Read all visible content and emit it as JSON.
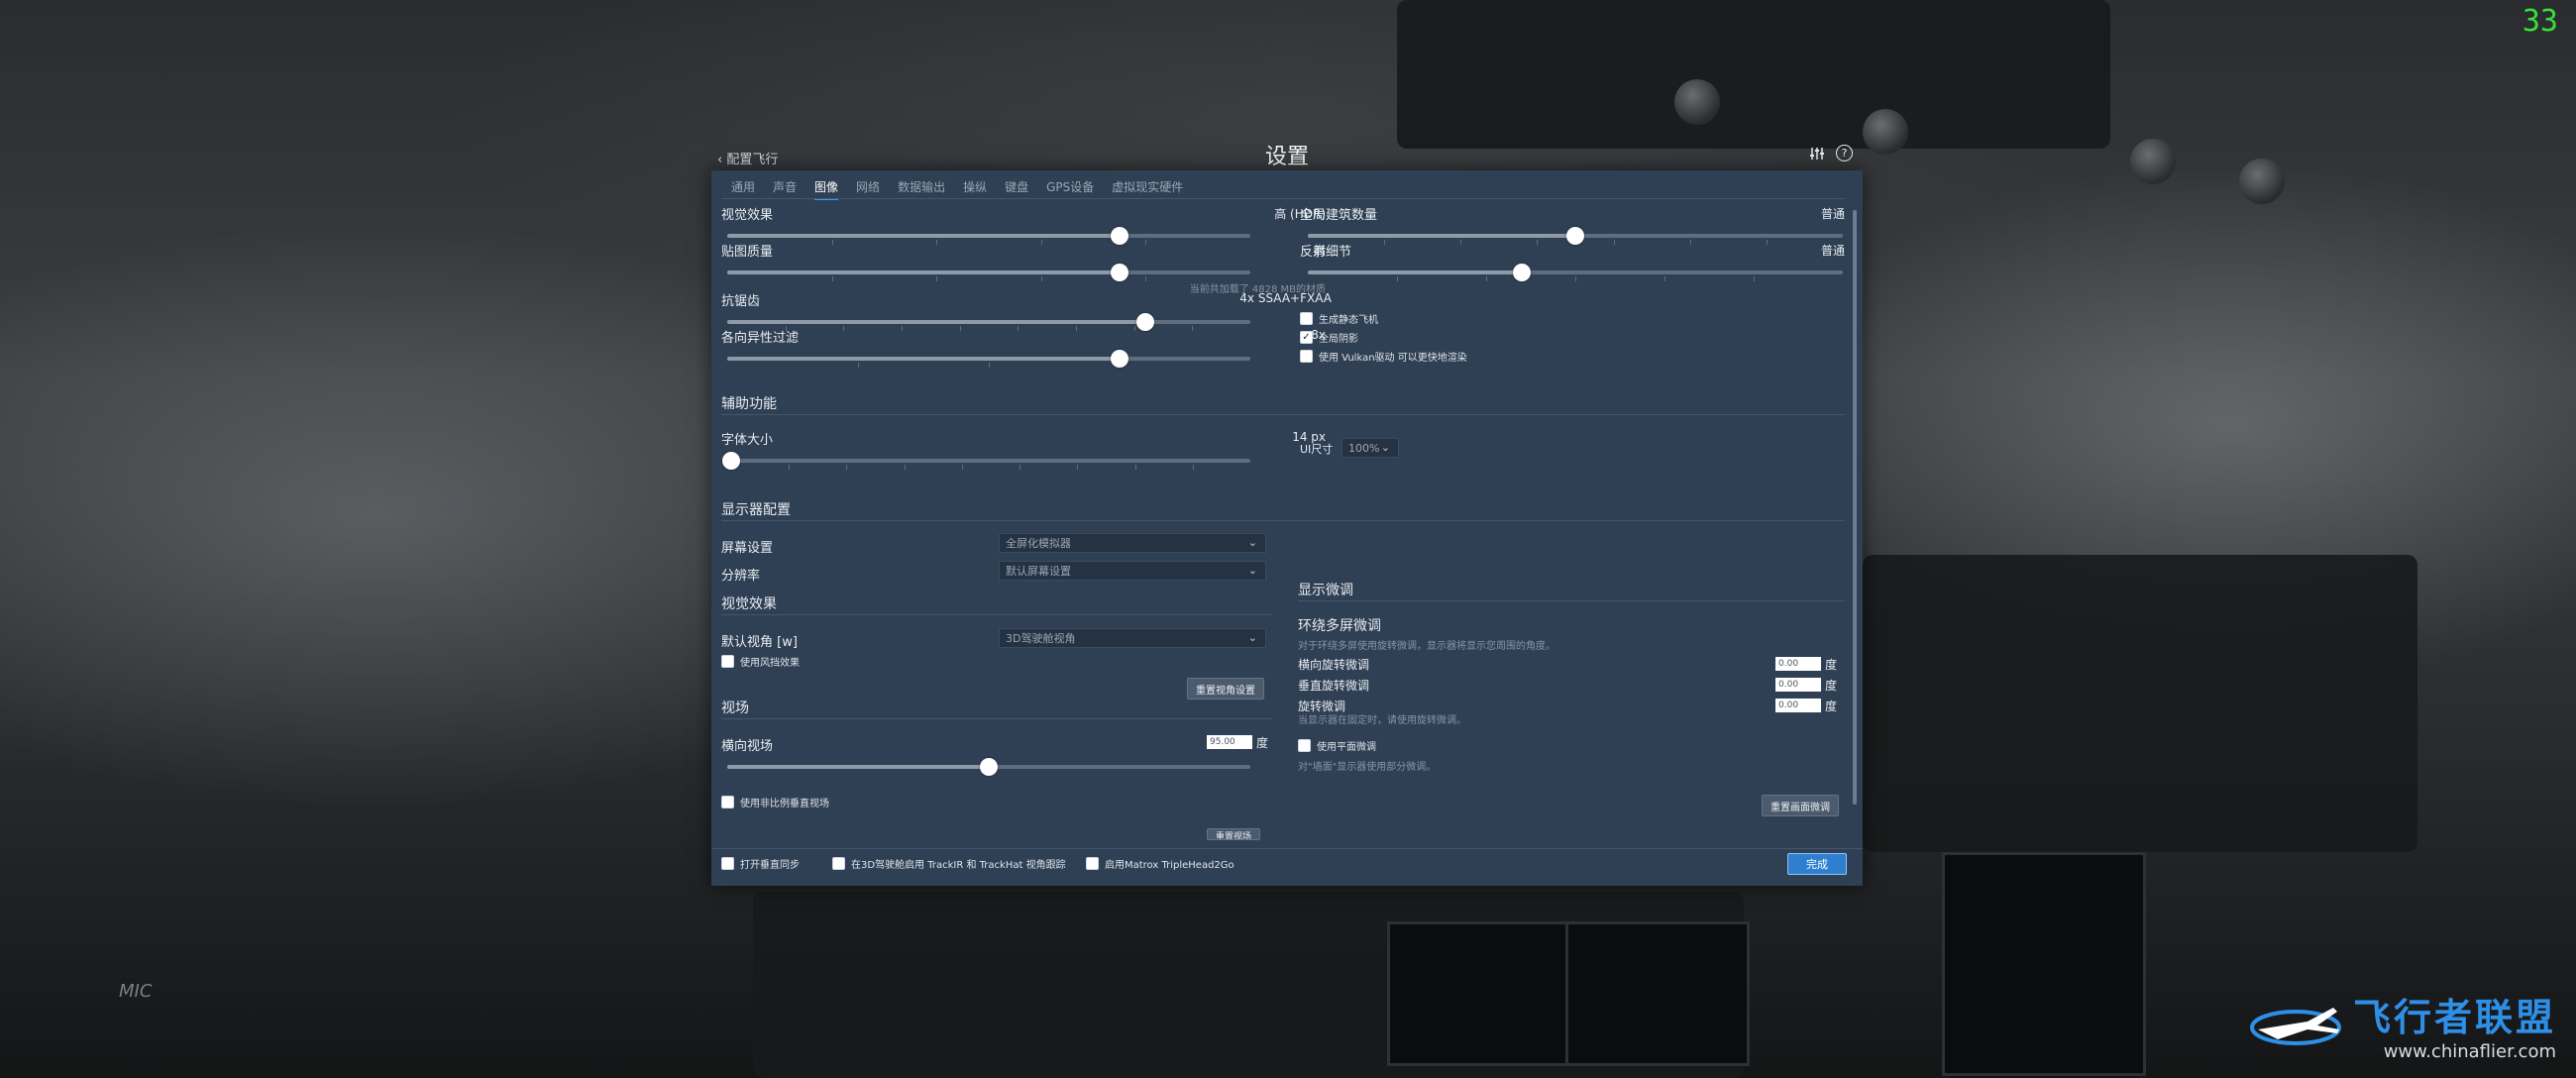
{
  "fps_counter": "33",
  "dialog": {
    "title": "设置",
    "back_label": "配置飞行",
    "tabs": [
      {
        "label": "通用",
        "active": false
      },
      {
        "label": "声音",
        "active": false
      },
      {
        "label": "图像",
        "active": true
      },
      {
        "label": "网络",
        "active": false
      },
      {
        "label": "数据输出",
        "active": false
      },
      {
        "label": "操纵",
        "active": false
      },
      {
        "label": "键盘",
        "active": false
      },
      {
        "label": "GPS设备",
        "active": false
      },
      {
        "label": "虚拟现实硬件",
        "active": false
      }
    ]
  },
  "graphics": {
    "visual_effects": {
      "label": "视觉效果",
      "value": "高 (HDR)",
      "level": 0.75
    },
    "texture_quality": {
      "label": "贴图质量",
      "value": "高",
      "level": 0.75,
      "note": "当前共加载了 4828 MB的材质"
    },
    "antialiasing": {
      "label": "抗锯齿",
      "value": "4x SSAA+FXAA",
      "level": 0.8
    },
    "anisotropic": {
      "label": "各向异性过滤",
      "value": "8x",
      "level": 0.75
    },
    "world_objects": {
      "label": "全局建筑数量",
      "value": "普通",
      "level": 0.5
    },
    "reflection_detail": {
      "label": "反射细节",
      "value": "普通",
      "level": 0.4
    },
    "checkboxes": [
      {
        "label": "生成静态飞机",
        "checked": false
      },
      {
        "label": "全局阴影",
        "checked": true
      },
      {
        "label": "使用 Vulkan驱动 可以更快地渲染",
        "checked": false
      }
    ]
  },
  "accessibility": {
    "section": "辅助功能",
    "font_size": {
      "label": "字体大小",
      "value": "14 px",
      "level": 0.0
    },
    "ui_size": {
      "label": "UI尺寸",
      "value": "100%"
    }
  },
  "monitor": {
    "section": "显示器配置",
    "screen_label": "屏幕设置",
    "screen_value": "全屏化模拟器",
    "resolution_label": "分辨率",
    "resolution_value": "默认屏幕设置"
  },
  "visual": {
    "section": "视觉效果",
    "default_view_label": "默认视角 [w]",
    "default_view_value": "3D驾驶舱视角",
    "wind_effect_label": "使用风挡效果",
    "wind_effect_checked": false,
    "reset_view_button": "重置视角设置"
  },
  "fov": {
    "section": "视场",
    "horizontal_label": "横向视场",
    "horizontal_value": "95.00",
    "unit": "度",
    "level": 0.5,
    "nonprop_label": "使用非比例垂直视场",
    "nonprop_checked": false,
    "reset_button_partial": "重置视场"
  },
  "display_adjust": {
    "section": "显示微调",
    "sub_title": "环绕多屏微调",
    "sub_desc": "对于环绕多屏使用旋转微调，显示器将显示您周围的角度。",
    "lateral_label": "横向旋转微调",
    "lateral_value": "0.00",
    "vertical_label": "垂直旋转微调",
    "vertical_value": "0.00",
    "roll_label": "旋转微调",
    "roll_value": "0.00",
    "roll_desc": "当显示器在固定时，请使用旋转微调。",
    "unit": "度",
    "flat_label": "使用平面微调",
    "flat_checked": false,
    "flat_desc": "对\"墙面\"显示器使用部分微调。",
    "reset_button": "重置画面微调"
  },
  "footer": {
    "vsync_label": "打开垂直同步",
    "vsync_checked": false,
    "trackir_label": "在3D驾驶舱启用 TrackIR 和 TrackHat 视角跟踪",
    "trackir_checked": false,
    "matrox_label": "启用Matrox TripleHead2Go",
    "matrox_checked": false,
    "done_button": "完成"
  },
  "watermark": {
    "title": "飞行者联盟",
    "url": "www.chinaflier.com"
  },
  "background_text": {
    "mic": "MIC"
  },
  "colors": {
    "panel": "#2f3f54",
    "accent": "#2f7fd0",
    "fps": "#35e03a"
  }
}
